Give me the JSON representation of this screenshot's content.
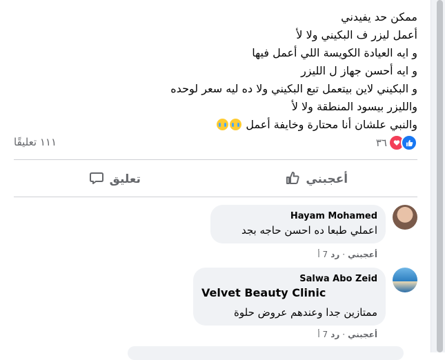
{
  "post": {
    "lines": [
      "ممكن حد يفيدني",
      "أعمل ليزر ف البكيني ولا لأ",
      "و ايه العيادة الكويسة اللي أعمل فيها",
      "و ايه أحسن جهاز ل الليزر",
      "و البكيني لاين بيتعمل تبع البكيني ولا ده ليه سعر لوحده",
      "والليزر بيسود المنطقة ولا لأ",
      "والنبي علشان أنا محتارة وخايفة أعمل"
    ],
    "emoji": [
      "crying-face-icon",
      "crying-face-icon"
    ]
  },
  "stats": {
    "reactions_count": "٣٦",
    "comments_count": "١١١ تعليقًا"
  },
  "actions": {
    "like_label": "أعجبني",
    "comment_label": "تعليق"
  },
  "comments": [
    {
      "author": "Hayam Mohamed",
      "text": "اعملي طبعا ده احسن حاجه بجد",
      "meta_like": "أعجبني",
      "meta_reply": "رد",
      "meta_time": "7 أ"
    },
    {
      "author": "Salwa Abo Zeid",
      "title": "Velvet Beauty Clinic",
      "text": "ممتازين جدا وعندهم عروض حلوة",
      "meta_like": "أعجبني",
      "meta_reply": "رد",
      "meta_time": "7 أ"
    }
  ],
  "colors": {
    "accent": "#1877f2",
    "love": "#f33e58",
    "secondary_text": "#65676b",
    "bubble": "#f0f2f5"
  }
}
